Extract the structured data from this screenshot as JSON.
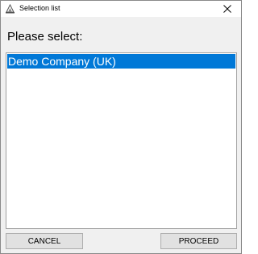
{
  "window": {
    "title": "Selection list",
    "icon": "app-icon",
    "close_glyph": "close-icon"
  },
  "prompt": "Please select:",
  "list": {
    "items": [
      {
        "label": "Demo Company (UK)",
        "selected": true
      }
    ]
  },
  "buttons": {
    "cancel_label": "CANCEL",
    "proceed_label": "PROCEED"
  },
  "colors": {
    "selection": "#0078d7",
    "window_bg": "#f0f0f0",
    "button_bg": "#e1e1e1"
  }
}
